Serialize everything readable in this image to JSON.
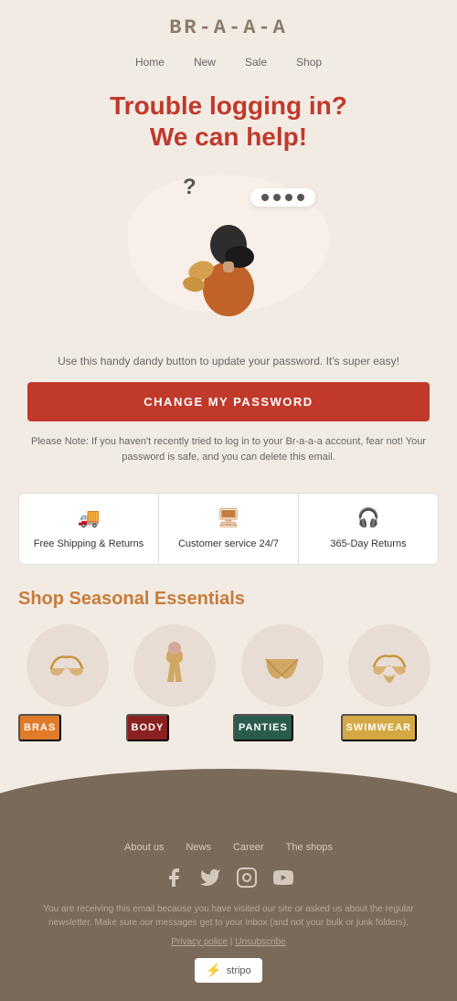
{
  "header": {
    "logo": "BR-A-A-A",
    "nav": [
      {
        "label": "Home",
        "href": "#"
      },
      {
        "label": "New",
        "href": "#"
      },
      {
        "label": "Sale",
        "href": "#"
      },
      {
        "label": "Shop",
        "href": "#"
      }
    ]
  },
  "hero": {
    "title_line1": "Trouble logging in?",
    "title_line2": "We can help!"
  },
  "body": {
    "description": "Use this handy dandy button to update your password. It's super easy!",
    "cta_label": "CHANGE MY PASSWORD",
    "note": "Please Note: If you haven't recently tried to log in to your Br-a-a-a account, fear not! Your password is safe, and you can delete this email."
  },
  "features": [
    {
      "icon": "🚚",
      "label": "Free Shipping & Returns"
    },
    {
      "icon": "🖥",
      "label": "Customer service 24/7"
    },
    {
      "icon": "🎧",
      "label": "365-Day Returns"
    }
  ],
  "shop": {
    "title": "Shop Seasonal Essentials",
    "items": [
      {
        "label": "BRAS",
        "btn_class": "btn-orange"
      },
      {
        "label": "BODY",
        "btn_class": "btn-red"
      },
      {
        "label": "PANTIES",
        "btn_class": "btn-teal"
      },
      {
        "label": "SWIMWEAR",
        "btn_class": "btn-gold"
      }
    ]
  },
  "footer": {
    "nav": [
      {
        "label": "About us"
      },
      {
        "label": "News"
      },
      {
        "label": "Career"
      },
      {
        "label": "The shops"
      }
    ],
    "social": [
      {
        "name": "facebook",
        "icon": "f"
      },
      {
        "name": "twitter",
        "icon": "t"
      },
      {
        "name": "instagram",
        "icon": "i"
      },
      {
        "name": "youtube",
        "icon": "▶"
      }
    ],
    "disclaimer": "You are receiving this email because you have visited our site or asked us about the regular newsletter. Make sure our messages get to your inbox (and not your bulk or junk folders).",
    "privacy": "Privacy police",
    "unsubscribe": "Unsubscribe",
    "stripo_label": "stripo"
  }
}
